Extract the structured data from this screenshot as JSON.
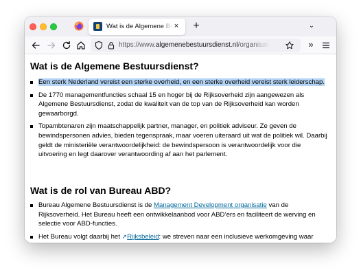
{
  "browser": {
    "tab_title": "Wat is de Algemene Bestuursdienst",
    "tab_close": "×",
    "new_tab": "+",
    "tab_list": "⌄",
    "url_scheme": "https://www.",
    "url_host": "algemenebestuursdienst.nl",
    "url_path": "/organisatie/algemene",
    "overflow_label": "»"
  },
  "section1": {
    "heading": "Wat is de Algemene Bestuursdienst?",
    "bullets": [
      "Een sterk Nederland vereist een sterke overheid, en een sterke overheid vereist sterk leiderschap.",
      "De 1770 managementfuncties schaal 15 en hoger bij de Rijksoverheid zijn aangewezen als Algemene Bestuursdienst, zodat de kwaliteit van de top van de Rijksoverheid kan worden gewaarborgd.",
      "Topambtenaren zijn maatschappelijk partner, manager, en politiek adviseur. Ze geven de bewindspersonen advies, bieden tegenspraak, maar voeren uiteraard uit wat de politiek wil. Daarbij geldt de ministeriële verantwoordelijkheid: de bewindspersoon is verantwoordelijk voor die uitvoering en legt daarover verantwoording af aan het parlement."
    ]
  },
  "section2": {
    "heading": "Wat is de rol van Bureau ABD?",
    "bullet1_pre": "Bureau Algemene Bestuursdienst is de ",
    "bullet1_link": "Management Development organisatie",
    "bullet1_post": " van de Rijksoverheid. Het Bureau heeft een ontwikkelaanbod voor ABD’ers en faciliteert de werving en selectie voor ABD-functies.",
    "bullet2_pre": "Het Bureau volgt daarbij het ",
    "bullet2_link_icon": "➚",
    "bullet2_link": "Rijksbeleid",
    "bullet2_post": ": we streven naar een inclusieve werkomgeving waar respect, samenwerking en aandacht voor individuele kwaliteit en (talent)ontwikkelmogelijkheden voorop staan zodat medewerkers het beste tot hun recht komen."
  },
  "colors": {
    "link": "#01689b",
    "selection_highlight": "#b4d4f5",
    "tab_strip": "#f0f0f4"
  },
  "icons": [
    "firefox-icon",
    "back-icon",
    "forward-icon",
    "reload-icon",
    "home-icon",
    "shield-icon",
    "lock-icon",
    "star-icon",
    "hamburger-menu-icon",
    "external-link-icon"
  ]
}
